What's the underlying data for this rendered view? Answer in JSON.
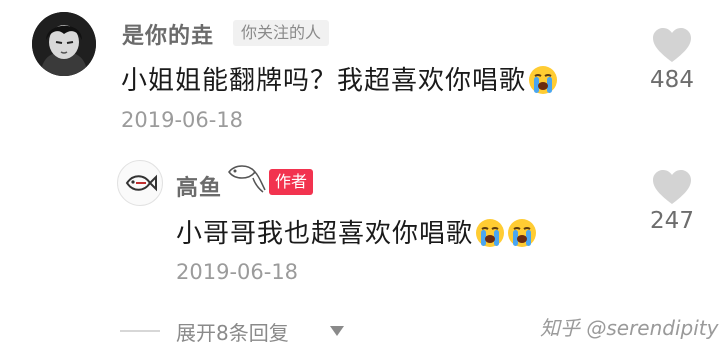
{
  "comment1": {
    "username": "是你的垚",
    "tag": "你关注的人",
    "text": "小姐姐能翻牌吗？我超喜欢你唱歌",
    "emoji_icons": [
      "loudly-crying-face"
    ],
    "date": "2019-06-18",
    "likes": "484"
  },
  "reply1": {
    "username": "高鱼",
    "tag": "作者",
    "text": "小哥哥我也超喜欢你唱歌",
    "emoji_icons": [
      "loudly-crying-face",
      "loudly-crying-face"
    ],
    "date": "2019-06-18",
    "likes": "247"
  },
  "expand": {
    "label": "展开8条回复"
  },
  "watermark": "知乎 @serendipity",
  "colors": {
    "author_tag": "#f2334f",
    "heart": "#d3d3d3",
    "name": "#6b6b6b"
  }
}
